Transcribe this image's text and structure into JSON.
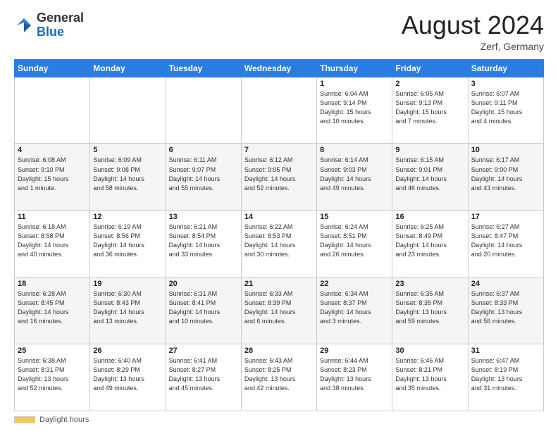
{
  "header": {
    "logo_general": "General",
    "logo_blue": "Blue",
    "month_title": "August 2024",
    "location": "Zerf, Germany"
  },
  "footer": {
    "daylight_label": "Daylight hours"
  },
  "days_of_week": [
    "Sunday",
    "Monday",
    "Tuesday",
    "Wednesday",
    "Thursday",
    "Friday",
    "Saturday"
  ],
  "weeks": [
    {
      "days": [
        {
          "number": "",
          "info": ""
        },
        {
          "number": "",
          "info": ""
        },
        {
          "number": "",
          "info": ""
        },
        {
          "number": "",
          "info": ""
        },
        {
          "number": "1",
          "info": "Sunrise: 6:04 AM\nSunset: 9:14 PM\nDaylight: 15 hours\nand 10 minutes."
        },
        {
          "number": "2",
          "info": "Sunrise: 6:05 AM\nSunset: 9:13 PM\nDaylight: 15 hours\nand 7 minutes."
        },
        {
          "number": "3",
          "info": "Sunrise: 6:07 AM\nSunset: 9:11 PM\nDaylight: 15 hours\nand 4 minutes."
        }
      ]
    },
    {
      "days": [
        {
          "number": "4",
          "info": "Sunrise: 6:08 AM\nSunset: 9:10 PM\nDaylight: 15 hours\nand 1 minute."
        },
        {
          "number": "5",
          "info": "Sunrise: 6:09 AM\nSunset: 9:08 PM\nDaylight: 14 hours\nand 58 minutes."
        },
        {
          "number": "6",
          "info": "Sunrise: 6:11 AM\nSunset: 9:07 PM\nDaylight: 14 hours\nand 55 minutes."
        },
        {
          "number": "7",
          "info": "Sunrise: 6:12 AM\nSunset: 9:05 PM\nDaylight: 14 hours\nand 52 minutes."
        },
        {
          "number": "8",
          "info": "Sunrise: 6:14 AM\nSunset: 9:03 PM\nDaylight: 14 hours\nand 49 minutes."
        },
        {
          "number": "9",
          "info": "Sunrise: 6:15 AM\nSunset: 9:01 PM\nDaylight: 14 hours\nand 46 minutes."
        },
        {
          "number": "10",
          "info": "Sunrise: 6:17 AM\nSunset: 9:00 PM\nDaylight: 14 hours\nand 43 minutes."
        }
      ]
    },
    {
      "days": [
        {
          "number": "11",
          "info": "Sunrise: 6:18 AM\nSunset: 8:58 PM\nDaylight: 14 hours\nand 40 minutes."
        },
        {
          "number": "12",
          "info": "Sunrise: 6:19 AM\nSunset: 8:56 PM\nDaylight: 14 hours\nand 36 minutes."
        },
        {
          "number": "13",
          "info": "Sunrise: 6:21 AM\nSunset: 8:54 PM\nDaylight: 14 hours\nand 33 minutes."
        },
        {
          "number": "14",
          "info": "Sunrise: 6:22 AM\nSunset: 8:53 PM\nDaylight: 14 hours\nand 30 minutes."
        },
        {
          "number": "15",
          "info": "Sunrise: 6:24 AM\nSunset: 8:51 PM\nDaylight: 14 hours\nand 26 minutes."
        },
        {
          "number": "16",
          "info": "Sunrise: 6:25 AM\nSunset: 8:49 PM\nDaylight: 14 hours\nand 23 minutes."
        },
        {
          "number": "17",
          "info": "Sunrise: 6:27 AM\nSunset: 8:47 PM\nDaylight: 14 hours\nand 20 minutes."
        }
      ]
    },
    {
      "days": [
        {
          "number": "18",
          "info": "Sunrise: 6:28 AM\nSunset: 8:45 PM\nDaylight: 14 hours\nand 16 minutes."
        },
        {
          "number": "19",
          "info": "Sunrise: 6:30 AM\nSunset: 8:43 PM\nDaylight: 14 hours\nand 13 minutes."
        },
        {
          "number": "20",
          "info": "Sunrise: 6:31 AM\nSunset: 8:41 PM\nDaylight: 14 hours\nand 10 minutes."
        },
        {
          "number": "21",
          "info": "Sunrise: 6:33 AM\nSunset: 8:39 PM\nDaylight: 14 hours\nand 6 minutes."
        },
        {
          "number": "22",
          "info": "Sunrise: 6:34 AM\nSunset: 8:37 PM\nDaylight: 14 hours\nand 3 minutes."
        },
        {
          "number": "23",
          "info": "Sunrise: 6:35 AM\nSunset: 8:35 PM\nDaylight: 13 hours\nand 59 minutes."
        },
        {
          "number": "24",
          "info": "Sunrise: 6:37 AM\nSunset: 8:33 PM\nDaylight: 13 hours\nand 56 minutes."
        }
      ]
    },
    {
      "days": [
        {
          "number": "25",
          "info": "Sunrise: 6:38 AM\nSunset: 8:31 PM\nDaylight: 13 hours\nand 52 minutes."
        },
        {
          "number": "26",
          "info": "Sunrise: 6:40 AM\nSunset: 8:29 PM\nDaylight: 13 hours\nand 49 minutes."
        },
        {
          "number": "27",
          "info": "Sunrise: 6:41 AM\nSunset: 8:27 PM\nDaylight: 13 hours\nand 45 minutes."
        },
        {
          "number": "28",
          "info": "Sunrise: 6:43 AM\nSunset: 8:25 PM\nDaylight: 13 hours\nand 42 minutes."
        },
        {
          "number": "29",
          "info": "Sunrise: 6:44 AM\nSunset: 8:23 PM\nDaylight: 13 hours\nand 38 minutes."
        },
        {
          "number": "30",
          "info": "Sunrise: 6:46 AM\nSunset: 8:21 PM\nDaylight: 13 hours\nand 35 minutes."
        },
        {
          "number": "31",
          "info": "Sunrise: 6:47 AM\nSunset: 8:19 PM\nDaylight: 13 hours\nand 31 minutes."
        }
      ]
    }
  ]
}
